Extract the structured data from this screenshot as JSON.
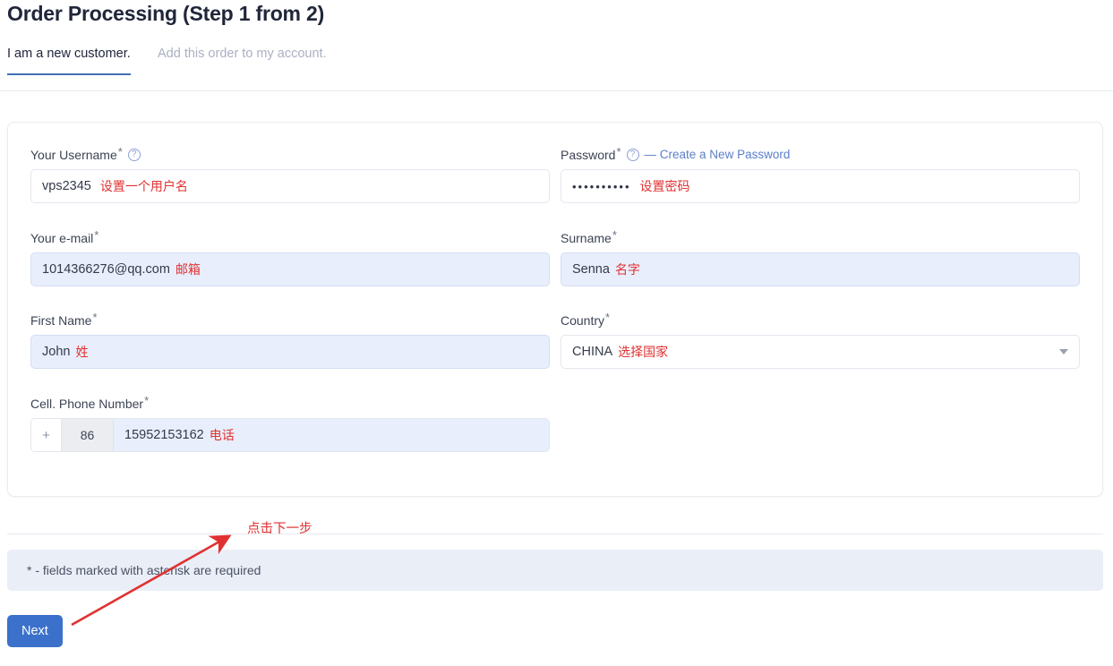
{
  "header": {
    "title": "Order Processing (Step 1 from 2)",
    "tabs": [
      {
        "label": "I am a new customer.",
        "active": true
      },
      {
        "label": "Add this order to my account.",
        "active": false
      }
    ]
  },
  "form": {
    "username": {
      "label": "Your Username",
      "required_mark": "*",
      "help_icon": "question-circle-icon",
      "value": "vps2345",
      "annotation": "设置一个用户名"
    },
    "password": {
      "label": "Password",
      "required_mark": "*",
      "help_icon": "question-circle-icon",
      "link": "— Create a New Password",
      "value": "••••••••••",
      "annotation": "设置密码"
    },
    "email": {
      "label": "Your e-mail",
      "required_mark": "*",
      "value": "1014366276@qq.com",
      "annotation": "邮箱"
    },
    "surname": {
      "label": "Surname",
      "required_mark": "*",
      "value": "Senna",
      "annotation": "名字"
    },
    "first_name": {
      "label": "First Name",
      "required_mark": "*",
      "value": "John",
      "annotation": "姓"
    },
    "country": {
      "label": "Country",
      "required_mark": "*",
      "value": "CHINA",
      "annotation": "选择国家",
      "caret_icon": "chevron-down-icon"
    },
    "phone": {
      "label": "Cell. Phone Number",
      "required_mark": "*",
      "plus": "+",
      "country_code": "86",
      "number": "15952153162",
      "annotation": "电话"
    }
  },
  "footer": {
    "info": "* - fields marked with asterisk are required",
    "next_label": "Next",
    "arrow_annotation": "点击下一步"
  },
  "colors": {
    "accent": "#3b71ca",
    "tab_active_underline": "#3f6fb5",
    "annotation_red": "#e03131",
    "autofill_bg": "#e8eefb",
    "info_bar_bg": "#eaeef7",
    "link_blue": "#5b7fc7",
    "title_text": "#20263a",
    "inactive_tab": "#a9b0c0"
  }
}
